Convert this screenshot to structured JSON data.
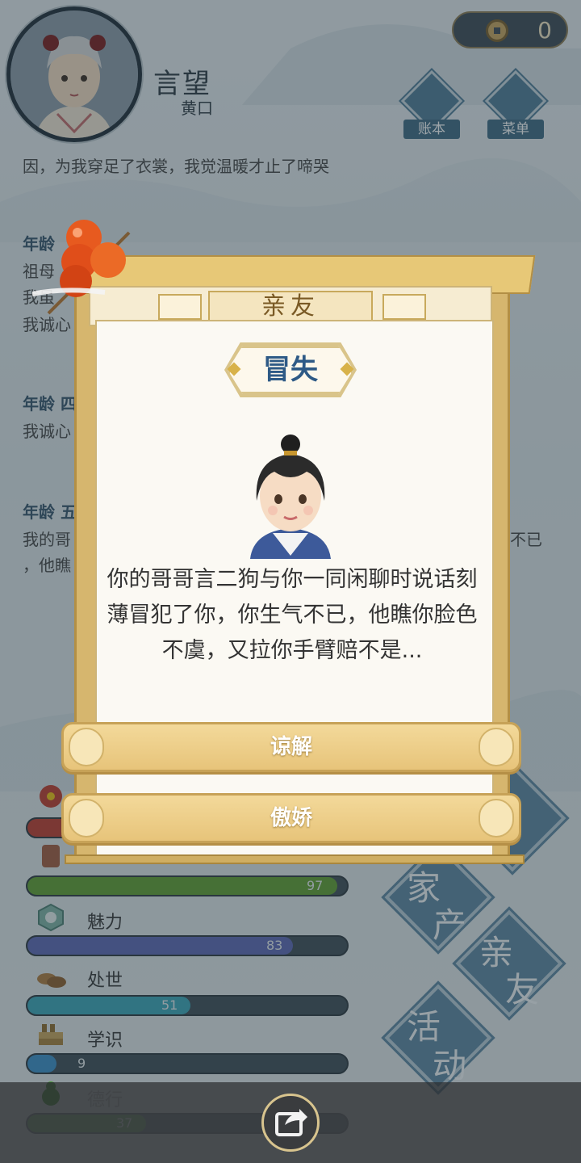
{
  "header": {
    "player_name": "言望",
    "player_title": "黄口",
    "coins": "0",
    "buttons": [
      {
        "label": "账本",
        "icon": "ledger-icon"
      },
      {
        "label": "菜单",
        "icon": "menu-dots-icon"
      }
    ]
  },
  "feed": {
    "line_top": "因，为我穿足了衣裳，我觉温暖才止了啼哭",
    "entries": [
      {
        "age": "年龄",
        "lines": [
          "祖母",
          "我虽",
          "我诚心"
        ]
      },
      {
        "age": "年龄 四",
        "lines": [
          "我诚心"
        ]
      },
      {
        "age": "年龄 五",
        "lines": [
          "我的哥",
          "，他瞧"
        ],
        "tail": "不已"
      }
    ]
  },
  "stats": [
    {
      "label": "",
      "value": null,
      "icon": "flower-icon",
      "color": "#c0392b"
    },
    {
      "label": "",
      "value": 97,
      "icon": "drum-icon",
      "color": "#5f9e2e"
    },
    {
      "label": "魅力",
      "value": 83,
      "icon": "jade-icon",
      "color": "#5c66b4"
    },
    {
      "label": "处世",
      "value": 51,
      "icon": "shoes-icon",
      "color": "#3aa6b8"
    },
    {
      "label": "学识",
      "value": 9,
      "icon": "books-icon",
      "color": "#3a8ec8"
    },
    {
      "label": "德行",
      "value": 37,
      "icon": "gourd-icon",
      "color": "#4c9a3a"
    }
  ],
  "right_menu": [
    {
      "label_1": "家",
      "label_2": "产"
    },
    {
      "label_1": "亲",
      "label_2": "友"
    },
    {
      "label_1": "活",
      "label_2": "动"
    }
  ],
  "dialog": {
    "title": "亲友",
    "event_name": "冒失",
    "character_icon": "brother-portrait-icon",
    "story": "你的哥哥言二狗与你一同闲聊时说话刻薄冒犯了你，你生气不已，他瞧你脸色不虞，又拉你手臂赔不是...",
    "choices": [
      "谅解",
      "傲娇"
    ]
  },
  "bottom": {
    "share_icon": "share-icon"
  },
  "colors": {
    "gold": "#d6b66e",
    "paper": "#fbf9f3",
    "accent_blue": "#2e5a86"
  }
}
